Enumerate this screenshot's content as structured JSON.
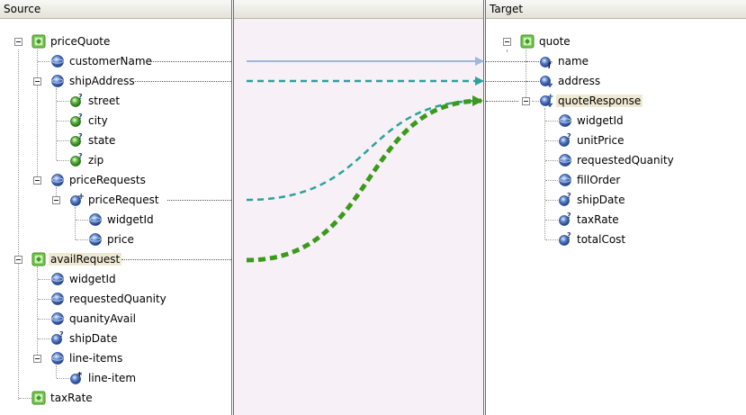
{
  "source": {
    "header": "Source",
    "nodes": {
      "priceQuote": "priceQuote",
      "customerName": "customerName",
      "shipAddress": "shipAddress",
      "street": "street",
      "city": "city",
      "state": "state",
      "zip": "zip",
      "priceRequests": "priceRequests",
      "priceRequest": "priceRequest",
      "widgetId": "widgetId",
      "price": "price",
      "availRequest": "availRequest",
      "avail_widgetId": "widgetId",
      "avail_requestedQuanity": "requestedQuanity",
      "avail_quanityAvail": "quanityAvail",
      "avail_shipDate": "shipDate",
      "lineItems": "line-items",
      "lineItem": "line-item",
      "taxRate": "taxRate"
    }
  },
  "target": {
    "header": "Target",
    "nodes": {
      "quote": "quote",
      "name": "name",
      "address": "address",
      "quoteResponse": "quoteResponse",
      "widgetId": "widgetId",
      "unitPrice": "unitPrice",
      "requestedQuanity": "requestedQuanity",
      "fillOrder": "fillOrder",
      "shipDate": "shipDate",
      "taxRate": "taxRate",
      "totalCost": "totalCost"
    }
  },
  "middle": {
    "header": ""
  },
  "colors": {
    "solid_link": "#9fb7d9",
    "dashed_link": "#2aa39a",
    "bold_link": "#3a9a1a",
    "selection": "#efe9d4"
  },
  "icons": {
    "complex": "green-element-icon",
    "simple": "blue-sphere-icon",
    "optional": "question-badge-icon",
    "repeating": "asterisk-badge-icon",
    "function": "function-badge-icon",
    "expanded": "plus-badge-icon"
  }
}
